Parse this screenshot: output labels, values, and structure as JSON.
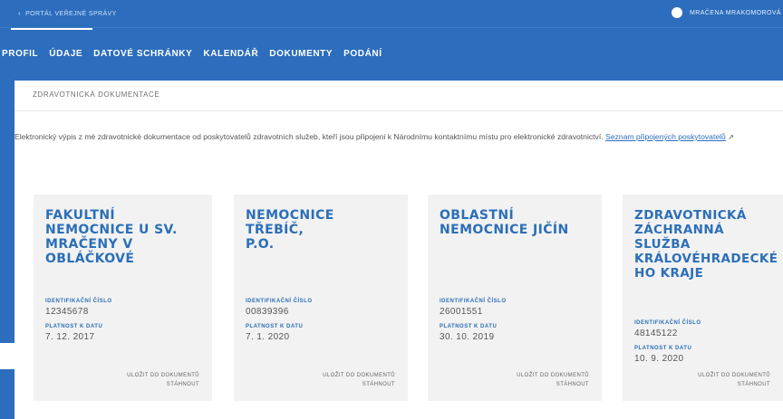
{
  "topbar": {
    "portal_label": "PORTÁL VEŘEJNÉ SPRÁVY",
    "user_name": "MRAČENA MRAKOMOROVÁ"
  },
  "nav": {
    "tabs": [
      {
        "label": "PROFIL"
      },
      {
        "label": "ÚDAJE"
      },
      {
        "label": "DATOVÉ SCHRÁNKY"
      },
      {
        "label": "KALENDÁŘ"
      },
      {
        "label": "DOKUMENTY"
      },
      {
        "label": "PODÁNÍ"
      }
    ]
  },
  "section": {
    "title": "ZDRAVOTNICKÁ DOKUMENTACE",
    "description": "Elektronický výpis z mé zdravotnické dokumentace od poskytovatelů zdravotních služeb, kteří jsou připojeni k Národnímu kontaktnímu místu pro elektronické zdravotnictví.",
    "link_text": "Seznam připojených poskytovatelů"
  },
  "labels": {
    "id": "IDENTIFIKAČNÍ ČÍSLO",
    "valid": "PLATNOST K DATU",
    "save": "ULOŽIT DO DOKUMENTŮ",
    "download": "STÁHNOUT"
  },
  "cards": [
    {
      "name": "FAKULTNÍ\nNEMOCNICE U SV.\nMRAČENY V\nOBLÁČKOVÉ",
      "id": "12345678",
      "date": "7. 12. 2017"
    },
    {
      "name": "NEMOCNICE TŘEBÍČ,\nP.O.",
      "id": "00839396",
      "date": "7. 1. 2020"
    },
    {
      "name": "OBLASTNÍ\nNEMOCNICE JIČÍN",
      "id": "26001551",
      "date": "30. 10. 2019"
    },
    {
      "name": "ZDRAVOTNICKÁ\nZÁCHRANNÁ\nSLUŽBA\nKRÁLOVÉHRADECKÉ\nHO KRAJE",
      "id": "48145122",
      "date": "10. 9. 2020"
    }
  ],
  "colors": {
    "brand": "#2c6dbd",
    "card_bg": "#f2f2f2"
  }
}
